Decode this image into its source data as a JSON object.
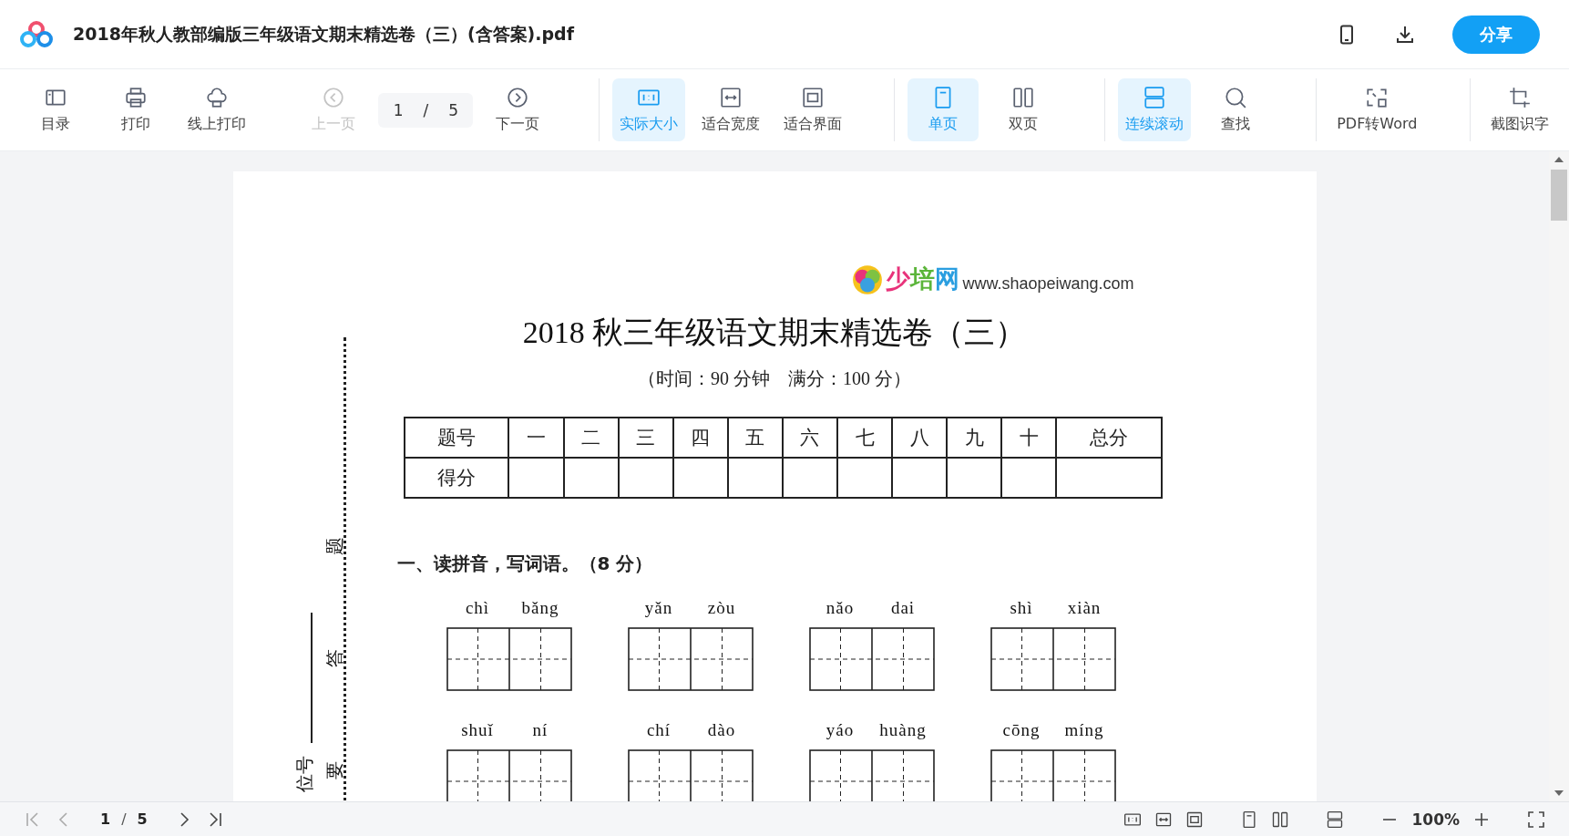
{
  "header": {
    "file_name": "2018年秋人教部编版三年级语文期末精选卷（三）(含答案).pdf",
    "share_button": "分享"
  },
  "toolbar": {
    "groups": [
      {
        "separated": false,
        "items": [
          {
            "kind": "toc",
            "label": "目录",
            "selected": false,
            "disabled": false
          },
          {
            "kind": "print",
            "label": "打印",
            "selected": false,
            "disabled": false
          },
          {
            "kind": "online-print",
            "label": "线上打印",
            "selected": false,
            "disabled": false
          }
        ]
      },
      {
        "separated": false,
        "items": [
          {
            "kind": "prev",
            "label": "上一页",
            "selected": false,
            "disabled": true
          },
          {
            "kind": "pager",
            "current": "1",
            "separator": "/",
            "total": "5"
          },
          {
            "kind": "next",
            "label": "下一页",
            "selected": false,
            "disabled": false
          }
        ]
      },
      {
        "separated": true,
        "items": [
          {
            "kind": "actual-size",
            "label": "实际大小",
            "selected": true,
            "disabled": false
          },
          {
            "kind": "fit-width",
            "label": "适合宽度",
            "selected": false,
            "disabled": false
          },
          {
            "kind": "fit-screen",
            "label": "适合界面",
            "selected": false,
            "disabled": false
          }
        ]
      },
      {
        "separated": true,
        "items": [
          {
            "kind": "single",
            "label": "单页",
            "selected": true,
            "disabled": false
          },
          {
            "kind": "double",
            "label": "双页",
            "selected": false,
            "disabled": false
          }
        ]
      },
      {
        "separated": true,
        "items": [
          {
            "kind": "continuous",
            "label": "连续滚动",
            "selected": true,
            "disabled": false
          },
          {
            "kind": "find",
            "label": "查找",
            "selected": false,
            "disabled": false
          }
        ]
      },
      {
        "separated": true,
        "items": [
          {
            "kind": "convert",
            "label": "PDF转Word",
            "selected": false,
            "disabled": false
          }
        ]
      },
      {
        "separated": true,
        "items": [
          {
            "kind": "ocr",
            "label": "截图识字",
            "selected": false,
            "disabled": false
          }
        ]
      }
    ]
  },
  "document": {
    "logo_text": "少培网",
    "logo_url": "www.shaopeiwang.com",
    "title": "2018 秋三年级语文期末精选卷（三）",
    "subtitle": "（时间：90 分钟　满分：100 分）",
    "score_table": {
      "header": [
        "题号",
        "一",
        "二",
        "三",
        "四",
        "五",
        "六",
        "七",
        "八",
        "九",
        "十",
        "总分"
      ],
      "score_label": "得分"
    },
    "binding_margin": {
      "marks": [
        "题",
        "答",
        "要"
      ],
      "label": "位号"
    },
    "section_heading": "一、读拼音，写词语。（8 分）",
    "word_rows": [
      [
        {
          "syllables": [
            "chì",
            "bǎng"
          ]
        },
        {
          "syllables": [
            "yǎn",
            "zòu"
          ]
        },
        {
          "syllables": [
            "nǎo",
            "dai"
          ]
        },
        {
          "syllables": [
            "shì",
            "xiàn"
          ]
        }
      ],
      [
        {
          "syllables": [
            "shuǐ",
            "ní"
          ]
        },
        {
          "syllables": [
            "chí",
            "dào"
          ]
        },
        {
          "syllables": [
            "yáo",
            "huàng"
          ]
        },
        {
          "syllables": [
            "cōng",
            "míng"
          ]
        }
      ]
    ]
  },
  "footer": {
    "current_page": "1",
    "separator": "/",
    "total_pages": "5",
    "zoom": "100%"
  }
}
